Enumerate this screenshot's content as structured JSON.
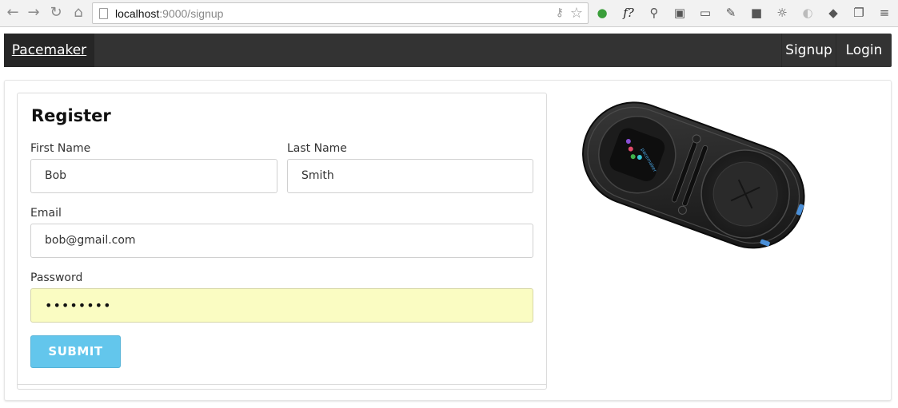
{
  "browser": {
    "url_host": "localhost",
    "url_rest": ":9000/signup"
  },
  "navbar": {
    "brand": "Pacemaker",
    "links": [
      "Signup",
      "Login"
    ]
  },
  "form": {
    "title": "Register",
    "first_name": {
      "label": "First Name",
      "value": "Bob"
    },
    "last_name": {
      "label": "Last Name",
      "value": "Smith"
    },
    "email": {
      "label": "Email",
      "value": "bob@gmail.com"
    },
    "password": {
      "label": "Password",
      "value": "••••••••"
    },
    "submit_label": "SUBMIT"
  },
  "device_image": {
    "brand_text": "pacemaker"
  },
  "colors": {
    "navbar": "#333333",
    "submit": "#63c6ec",
    "autofill": "#fafcc2"
  }
}
